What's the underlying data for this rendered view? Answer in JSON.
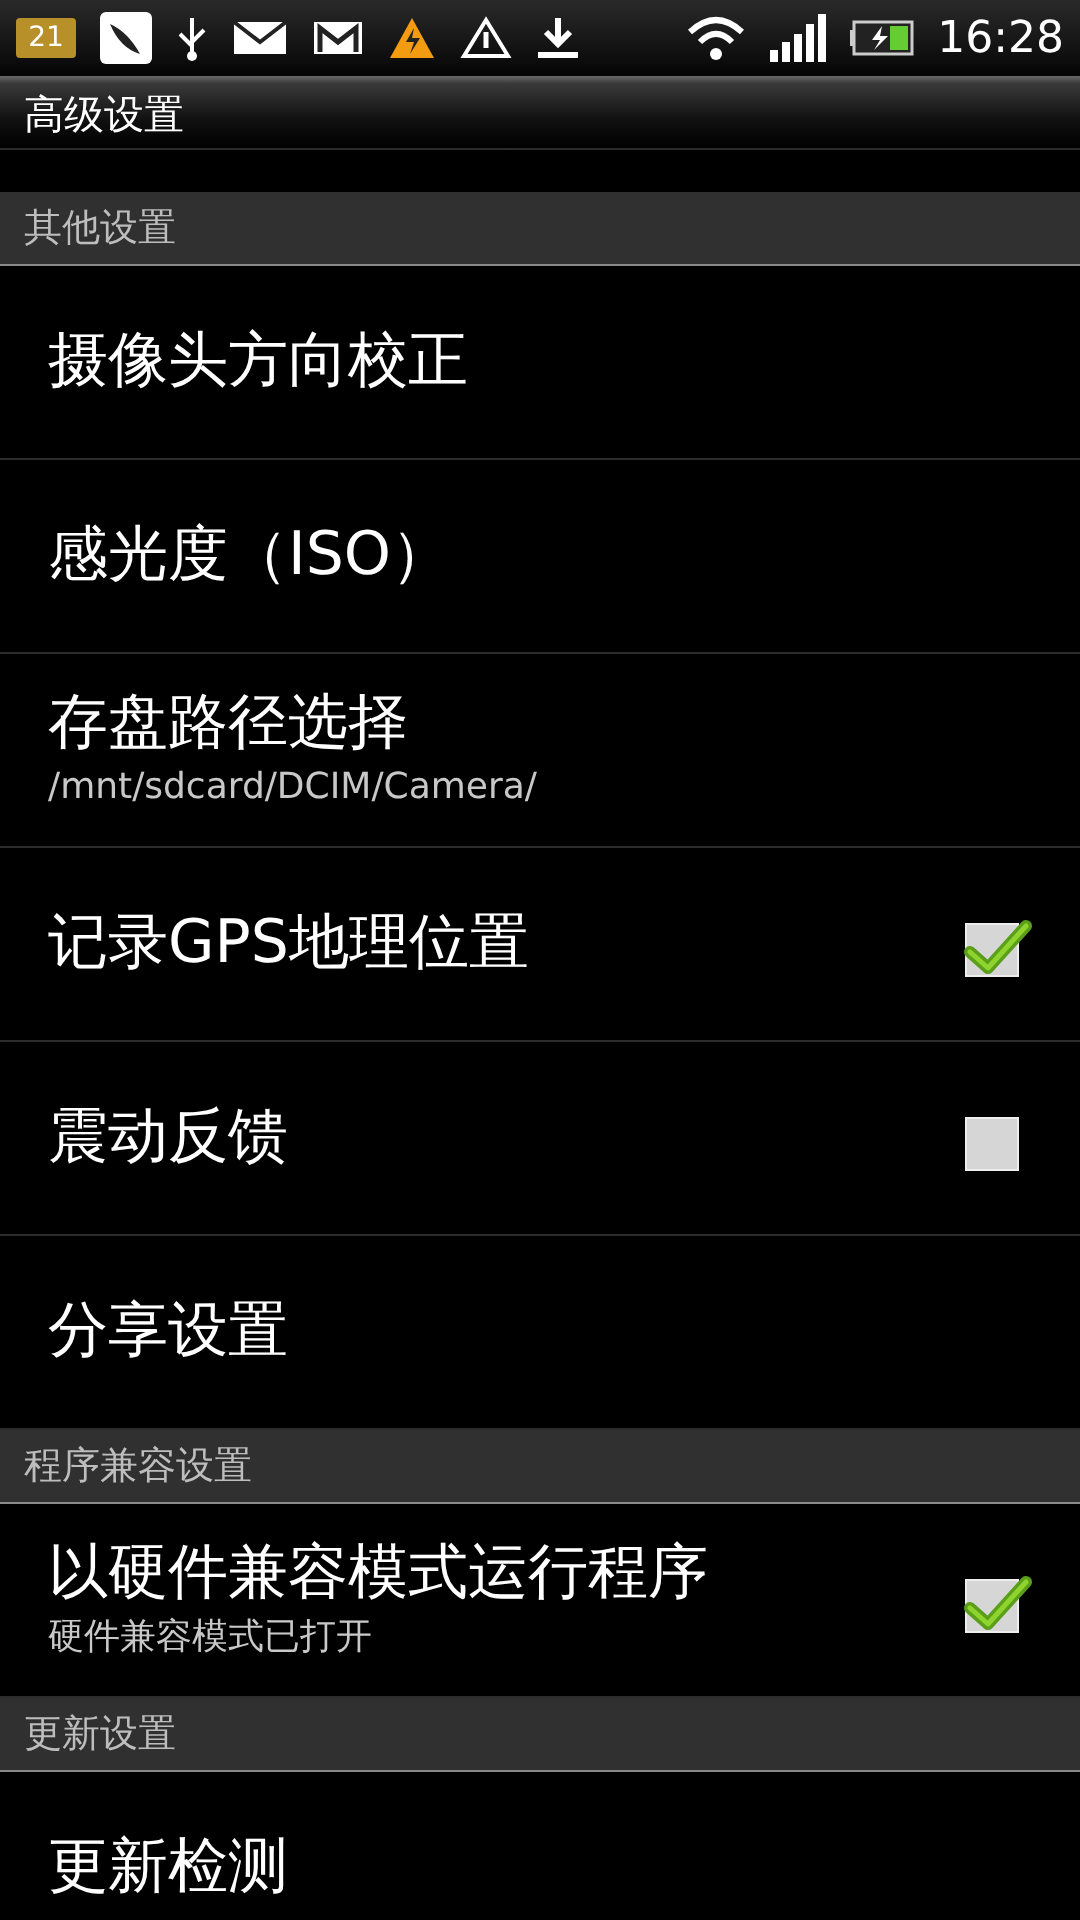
{
  "status_bar": {
    "calendar_day": "21",
    "time": "16:28"
  },
  "title": "高级设置",
  "sections": [
    {
      "header": "其他设置",
      "items": [
        {
          "kind": "plain",
          "title": "摄像头方向校正"
        },
        {
          "kind": "plain",
          "title": "感光度（ISO）"
        },
        {
          "kind": "plain",
          "title": "存盘路径选择",
          "summary": "/mnt/sdcard/DCIM/Camera/"
        },
        {
          "kind": "check",
          "title": "记录GPS地理位置",
          "checked": true
        },
        {
          "kind": "check",
          "title": "震动反馈",
          "checked": false
        },
        {
          "kind": "plain",
          "title": "分享设置"
        }
      ]
    },
    {
      "header": "程序兼容设置",
      "items": [
        {
          "kind": "check",
          "title": "以硬件兼容模式运行程序",
          "summary": "硬件兼容模式已打开",
          "checked": true
        }
      ]
    },
    {
      "header": "更新设置",
      "items": [
        {
          "kind": "plain",
          "title": "更新检测"
        }
      ]
    }
  ]
}
